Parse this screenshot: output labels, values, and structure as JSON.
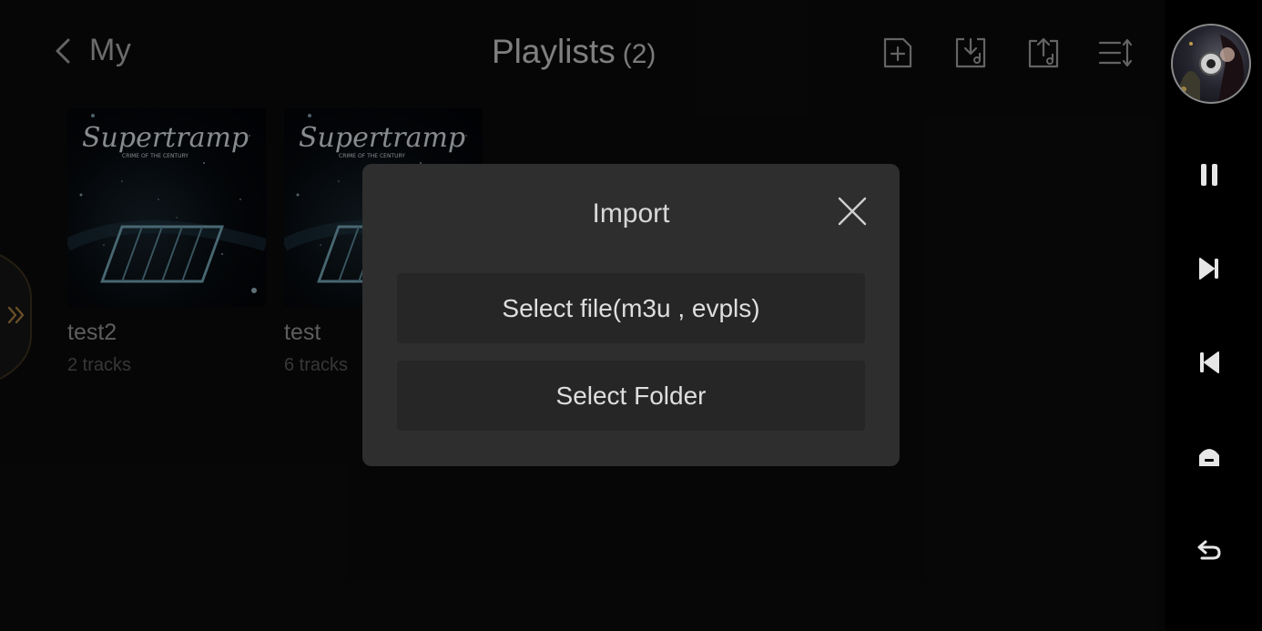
{
  "header": {
    "back_label": "My",
    "title": "Playlists",
    "count": "(2)",
    "tools": [
      {
        "icon": "add-playlist-icon"
      },
      {
        "icon": "import-playlist-icon"
      },
      {
        "icon": "export-playlist-icon"
      },
      {
        "icon": "sort-icon"
      }
    ]
  },
  "playlists": [
    {
      "name": "test2",
      "tracks": "2 tracks",
      "cover_text": "Supertramp",
      "cover_sub": "CRIME OF THE CENTURY"
    },
    {
      "name": "test",
      "tracks": "6 tracks",
      "cover_text": "Supertramp",
      "cover_sub": "CRIME OF THE CENTURY"
    }
  ],
  "drawer": {
    "icon": "double-chevron-right-icon",
    "accent": "#a07a3c"
  },
  "rail": {
    "buttons": [
      {
        "icon": "pause-icon"
      },
      {
        "icon": "next-track-icon"
      },
      {
        "icon": "previous-track-icon"
      },
      {
        "icon": "home-icon"
      },
      {
        "icon": "return-icon"
      }
    ]
  },
  "dialog": {
    "title": "Import",
    "option_file": "Select file(m3u , evpls)",
    "option_folder": "Select Folder"
  },
  "colors": {
    "background": "#0a0a0a",
    "dialog": "#2e2e2e",
    "option": "#262626",
    "rail": "#000000"
  }
}
